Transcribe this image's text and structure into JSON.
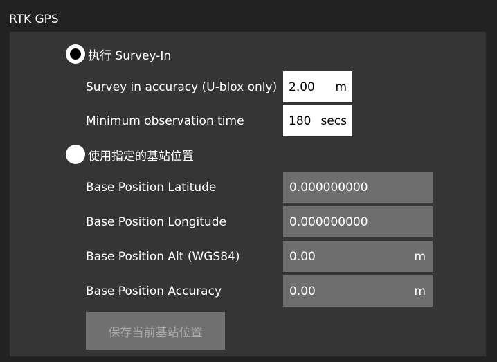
{
  "section": {
    "title": "RTK GPS"
  },
  "survey_in": {
    "radio_label": "执行 Survey-In",
    "selected": true,
    "accuracy": {
      "label": "Survey in accuracy (U-blox only)",
      "value": "2.00",
      "unit": "m"
    },
    "min_time": {
      "label": "Minimum observation time",
      "value": "180",
      "unit": "secs"
    }
  },
  "fixed_base": {
    "radio_label": "使用指定的基站位置",
    "selected": false,
    "latitude": {
      "label": "Base Position Latitude",
      "value": "0.000000000"
    },
    "longitude": {
      "label": "Base Position Longitude",
      "value": "0.000000000"
    },
    "altitude": {
      "label": "Base Position Alt (WGS84)",
      "value": "0.00",
      "unit": "m"
    },
    "accuracy": {
      "label": "Base Position Accuracy",
      "value": "0.00",
      "unit": "m"
    },
    "save_button": "保存当前基站位置"
  }
}
